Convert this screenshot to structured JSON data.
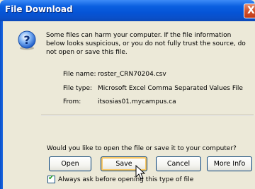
{
  "window": {
    "title": "File Download",
    "close_label": "X"
  },
  "message": {
    "warning": "Some files can harm your computer. If the file information below looks suspicious, or you do not fully trust the source, do not open or save this file."
  },
  "file_info": {
    "name_label": "File name:",
    "name_value": "roster_CRN70204.csv",
    "type_label": "File type:",
    "type_value": "Microsoft Excel Comma Separated Values File",
    "from_label": "From:",
    "from_value": "itsosias01.mycampus.ca"
  },
  "prompt": {
    "question": "Would you like to open the file or save it to your computer?"
  },
  "buttons": {
    "open": "Open",
    "save": "Save",
    "cancel": "Cancel",
    "more_info": "More Info"
  },
  "option": {
    "always_ask_label": "Always ask before opening this type of file",
    "always_ask_checked": true
  },
  "icons": {
    "warning": "question-mark-icon",
    "cursor": "mouse-pointer-icon"
  }
}
